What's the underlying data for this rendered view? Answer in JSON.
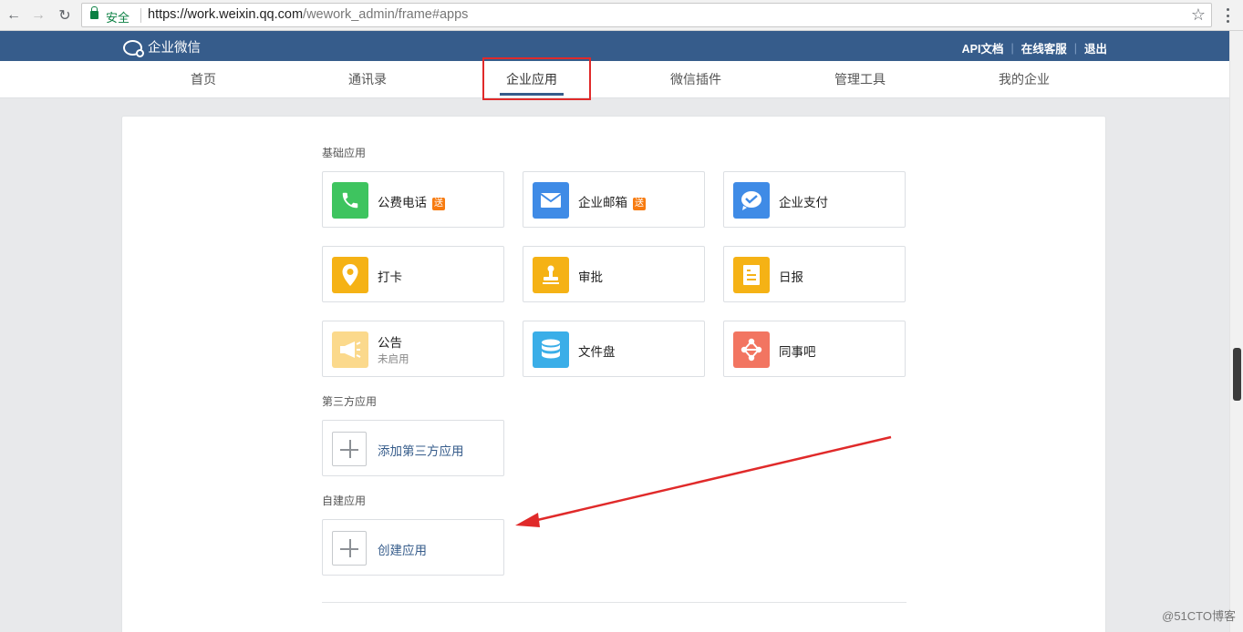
{
  "browser": {
    "secure_label": "安全",
    "url_main": "https://work.weixin.qq.com",
    "url_path": "/wework_admin/frame#apps"
  },
  "topbar": {
    "logo_text": "企业微信",
    "links": [
      "API文档",
      "在线客服",
      "退出"
    ]
  },
  "nav": {
    "items": [
      "首页",
      "通讯录",
      "企业应用",
      "微信插件",
      "管理工具",
      "我的企业"
    ],
    "active": "企业应用"
  },
  "sections": {
    "basic": "基础应用",
    "third_party": "第三方应用",
    "custom": "自建应用"
  },
  "apps": [
    {
      "name": "公费电话",
      "badge": "送",
      "icon": "phone-icon",
      "color": "#3ec45f"
    },
    {
      "name": "企业邮箱",
      "badge": "送",
      "icon": "mail-icon",
      "color": "#3f8be6"
    },
    {
      "name": "企业支付",
      "icon": "pay-icon",
      "color": "#3f8be6"
    },
    {
      "name": "打卡",
      "icon": "location-pin-icon",
      "color": "#f5b215"
    },
    {
      "name": "审批",
      "icon": "stamp-icon",
      "color": "#f5b215"
    },
    {
      "name": "日报",
      "icon": "report-icon",
      "color": "#f5b215"
    },
    {
      "name": "公告",
      "sub": "未启用",
      "icon": "megaphone-icon",
      "color": "#fbd98c"
    },
    {
      "name": "文件盘",
      "icon": "database-icon",
      "color": "#3aaee8"
    },
    {
      "name": "同事吧",
      "icon": "network-icon",
      "color": "#f27561"
    }
  ],
  "add_third_party": "添加第三方应用",
  "create_app": "创建应用",
  "watermark": "@51CTO博客"
}
